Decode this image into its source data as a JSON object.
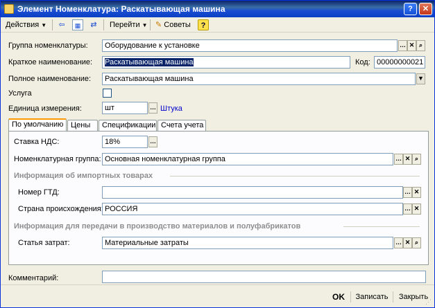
{
  "window": {
    "title": "Элемент Номенклатура: Раскатывающая машина",
    "help_btn": "?",
    "close_btn": "✕"
  },
  "toolbar": {
    "actions": "Действия",
    "goto": "Перейти",
    "tips": "Советы",
    "help": "?"
  },
  "form": {
    "group_label": "Группа номенклатуры:",
    "group_value": "Оборудование к установке",
    "short_name_label": "Краткое наименование:",
    "short_name_value": "Раскатывающая машина",
    "code_label": "Код:",
    "code_value": "00000000021",
    "full_name_label": "Полное наименование:",
    "full_name_value": "Раскатывающая машина",
    "service_label": "Услуга",
    "service_checked": false,
    "unit_label": "Единица измерения:",
    "unit_value": "шт",
    "unit_link": "Штука"
  },
  "tabs": [
    {
      "label": "По умолчанию",
      "active": true
    },
    {
      "label": "Цены",
      "active": false
    },
    {
      "label": "Спецификации",
      "active": false
    },
    {
      "label": "Счета учета",
      "active": false
    }
  ],
  "defaults": {
    "vat_label": "Ставка НДС:",
    "vat_value": "18%",
    "nomenclature_group_label": "Номенклатурная группа:",
    "nomenclature_group_value": "Основная номенклатурная группа",
    "import_section": "Информация об импортных товарах",
    "gtd_label": "Номер ГТД:",
    "gtd_value": "",
    "country_label": "Страна происхождения:",
    "country_value": "РОССИЯ",
    "production_section": "Информация для передачи в производство материалов и полуфабрикатов",
    "cost_item_label": "Статья затрат:",
    "cost_item_value": "Материальные затраты"
  },
  "comment": {
    "label": "Комментарий:",
    "value": ""
  },
  "footer": {
    "ok": "OK",
    "save": "Записать",
    "close": "Закрыть"
  }
}
